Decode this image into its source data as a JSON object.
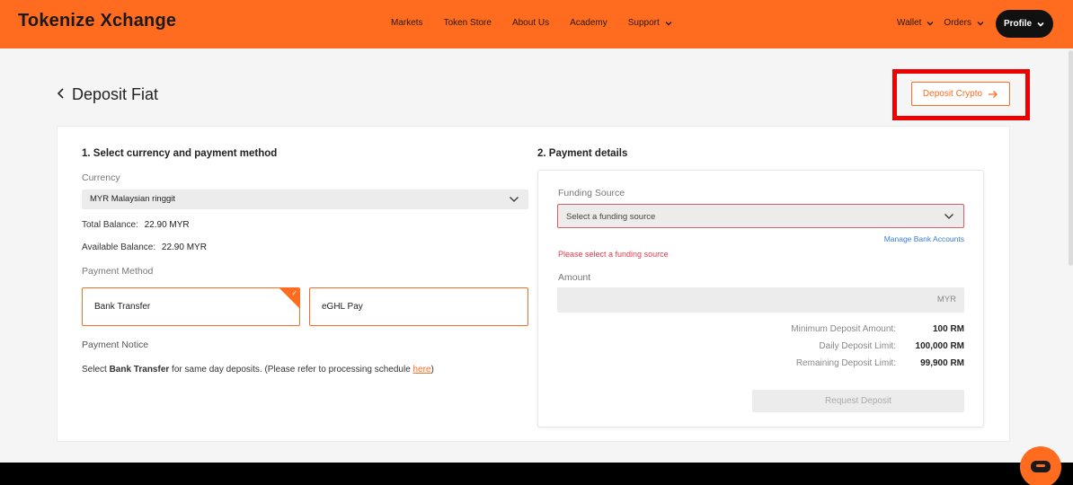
{
  "header": {
    "logo": "Tokenize Xchange",
    "nav": [
      "Markets",
      "Token Store",
      "About Us",
      "Academy",
      "Support"
    ],
    "right_nav": [
      "Wallet",
      "Orders"
    ],
    "profile": "Profile"
  },
  "page": {
    "title": "Deposit Fiat",
    "deposit_crypto_label": "Deposit Crypto"
  },
  "left": {
    "heading": "1. Select currency and payment method",
    "currency_label": "Currency",
    "currency_value": "MYR Malaysian ringgit",
    "total_balance_label": "Total Balance:",
    "total_balance_value": "22.90 MYR",
    "available_balance_label": "Available Balance:",
    "available_balance_value": "22.90 MYR",
    "payment_method_label": "Payment Method",
    "methods": [
      "Bank Transfer",
      "eGHL Pay"
    ],
    "selected_method": "Bank Transfer",
    "notice_label": "Payment Notice",
    "notice_prefix": "Select ",
    "notice_bold": "Bank Transfer",
    "notice_suffix": " for same day deposits. (Please refer to processing schedule ",
    "notice_link": "here",
    "notice_end": ")"
  },
  "right": {
    "heading": "2. Payment details",
    "funding_label": "Funding Source",
    "funding_placeholder": "Select a funding source",
    "manage_link": "Manage Bank Accounts",
    "error": "Please select a funding source",
    "amount_label": "Amount",
    "amount_unit": "MYR",
    "limits": [
      {
        "label": "Minimum Deposit Amount:",
        "value": "100 RM"
      },
      {
        "label": "Daily Deposit Limit:",
        "value": "100,000 RM"
      },
      {
        "label": "Remaining Deposit Limit:",
        "value": "99,900 RM"
      }
    ],
    "request_button": "Request Deposit"
  },
  "colors": {
    "brand": "#ff6b1f",
    "error": "#e03a4e",
    "highlight": "#ee0000",
    "link": "#3a7bd5"
  },
  "icons": [
    "back-arrow-icon",
    "chevron-down-icon",
    "arrow-right-icon",
    "check-icon",
    "chat-icon"
  ]
}
